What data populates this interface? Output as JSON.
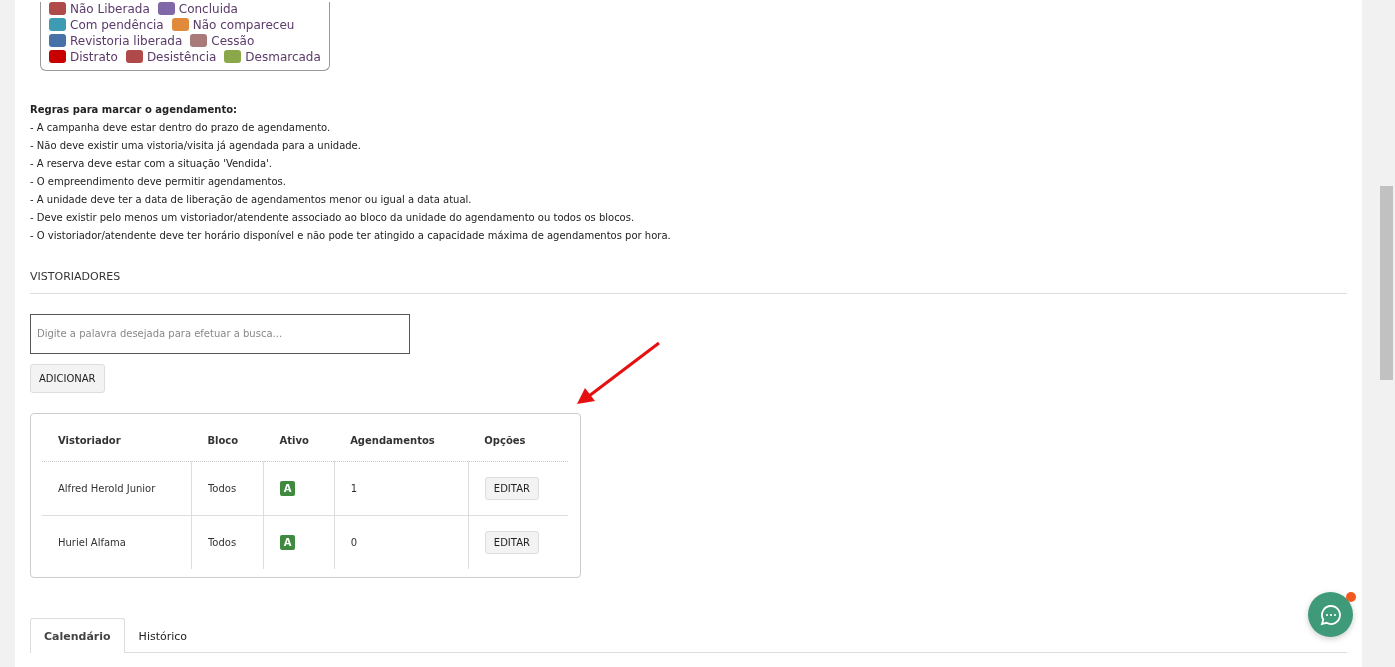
{
  "legend": [
    [
      {
        "label": "Não Liberada",
        "color": "#b04a4a"
      },
      {
        "label": "Concluida",
        "color": "#8067a8"
      }
    ],
    [
      {
        "label": "Com pendência",
        "color": "#3d9bb3"
      },
      {
        "label": "Não compareceu",
        "color": "#e08a3c"
      }
    ],
    [
      {
        "label": "Revistoria liberada",
        "color": "#4672a8"
      },
      {
        "label": "Cessão",
        "color": "#a87a7a"
      }
    ],
    [
      {
        "label": "Distrato",
        "color": "#c80000"
      },
      {
        "label": "Desistência",
        "color": "#b04a4a"
      },
      {
        "label": "Desmarcada",
        "color": "#8aa84a"
      }
    ]
  ],
  "rules": {
    "title": "Regras para marcar o agendamento:",
    "items": [
      "- A campanha deve estar dentro do prazo de agendamento.",
      "- Não deve existir uma vistoria/visita já agendada para a unidade.",
      "- A reserva deve estar com a situação 'Vendida'.",
      "- O empreendimento deve permitir agendamentos.",
      "- A unidade deve ter a data de liberação de agendamentos menor ou igual a data atual.",
      "- Deve existir pelo menos um vistoriador/atendente associado ao bloco da unidade do agendamento ou todos os blocos.",
      "- O vistoriador/atendente deve ter horário disponível e não pode ter atingido a capacidade máxima de agendamentos por hora."
    ]
  },
  "section_title": "VISTORIADORES",
  "search": {
    "placeholder": "Digite a palavra desejada para efetuar a busca..."
  },
  "add_button": "ADICIONAR",
  "table": {
    "columns": [
      "Vistoriador",
      "Bloco",
      "Ativo",
      "Agendamentos",
      "Opções"
    ],
    "rows": [
      {
        "name": "Alfred Herold Junior",
        "block": "Todos",
        "active": true,
        "active_label": "A",
        "count": "1",
        "action": "EDITAR"
      },
      {
        "name": "Huriel Alfama",
        "block": "Todos",
        "active": true,
        "active_label": "A",
        "count": "0",
        "action": "EDITAR"
      }
    ]
  },
  "tabs": [
    {
      "label": "Calendário",
      "selected": true
    },
    {
      "label": "Histórico",
      "selected": false
    }
  ],
  "chat": {
    "notification": true
  }
}
